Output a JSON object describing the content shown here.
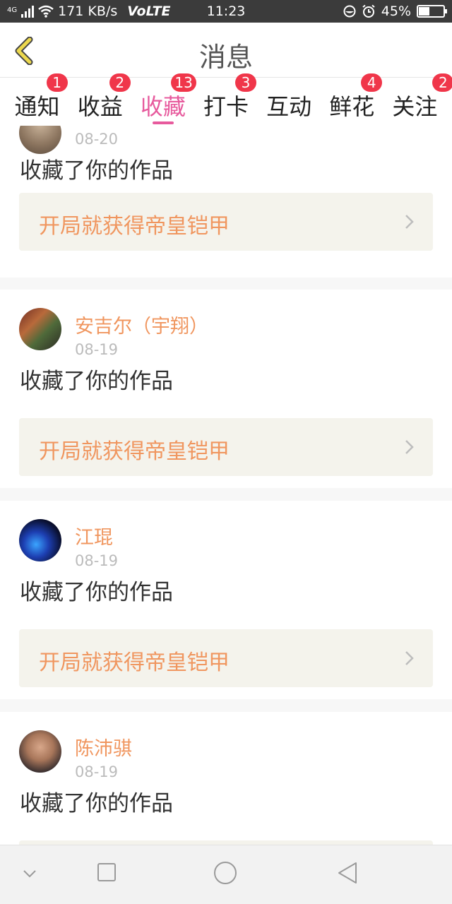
{
  "status_bar": {
    "network_label": "4G",
    "speed": "171 KB/s",
    "volte": "VoLTE",
    "time": "11:23",
    "battery": "45%",
    "battery_level": 0.45
  },
  "header": {
    "title": "消息",
    "accent_color": "#e8d850"
  },
  "tabs": [
    {
      "label": "通知",
      "badge": "1",
      "active": false
    },
    {
      "label": "收益",
      "badge": "2",
      "active": false
    },
    {
      "label": "收藏",
      "badge": "13",
      "active": true
    },
    {
      "label": "打卡",
      "badge": "3",
      "active": false
    },
    {
      "label": "互动",
      "badge": "",
      "active": false
    },
    {
      "label": "鲜花",
      "badge": "4",
      "active": false
    },
    {
      "label": "关注",
      "badge": "2",
      "active": false
    }
  ],
  "items": [
    {
      "name": "",
      "date": "08-20",
      "action": "收藏了你的作品",
      "work_title": "开局就获得帝皇铠甲"
    },
    {
      "name": "安吉尔（宇翔）",
      "date": "08-19",
      "action": "收藏了你的作品",
      "work_title": "开局就获得帝皇铠甲"
    },
    {
      "name": "江琨",
      "date": "08-19",
      "action": "收藏了你的作品",
      "work_title": "开局就获得帝皇铠甲"
    },
    {
      "name": "陈沛骐",
      "date": "08-19",
      "action": "收藏了你的作品",
      "work_title": ""
    }
  ],
  "colors": {
    "active_tab": "#e75a9d",
    "badge": "#f0364a",
    "name": "#f0965f",
    "work_bg": "#f4f3ec"
  }
}
